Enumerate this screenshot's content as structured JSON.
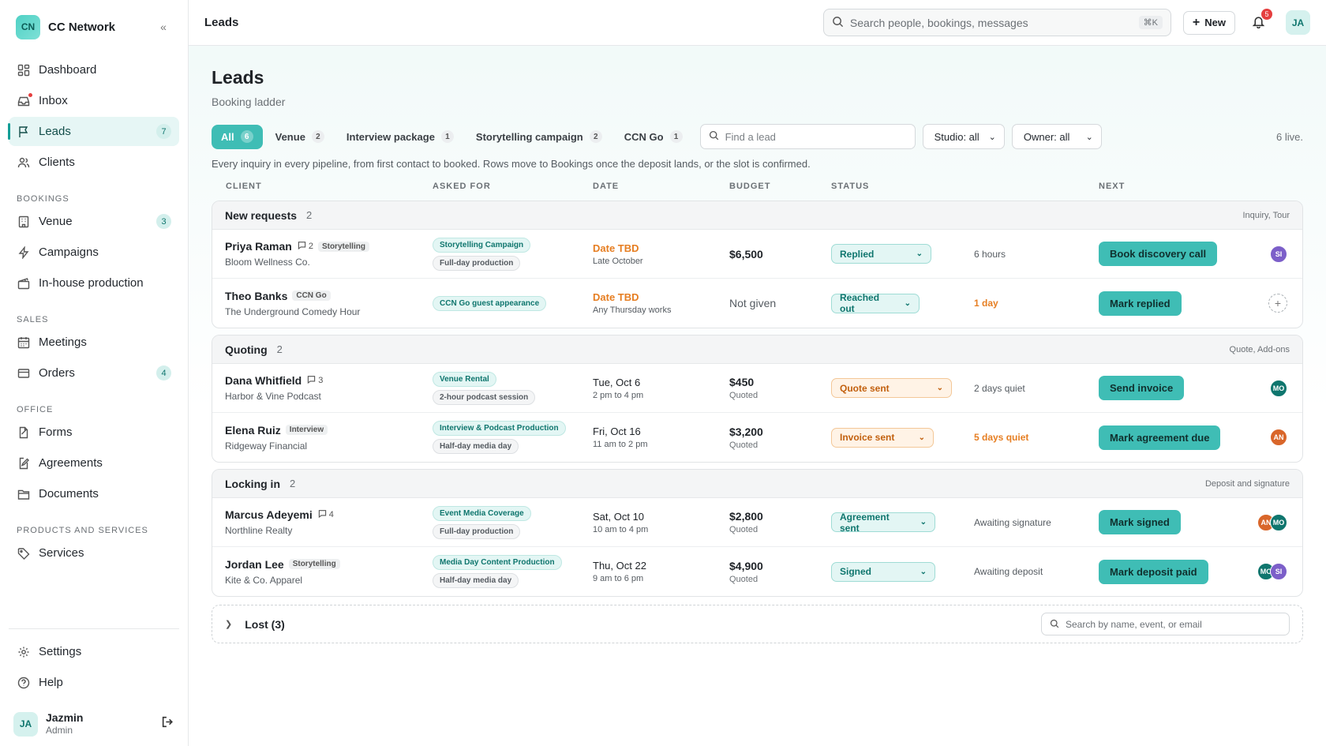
{
  "brand": {
    "initials": "CN",
    "name": "CC Network"
  },
  "sidebar": {
    "main": [
      {
        "label": "Dashboard",
        "icon": "dashboard-icon"
      },
      {
        "label": "Inbox",
        "icon": "inbox-icon"
      },
      {
        "label": "Leads",
        "icon": "flag-icon",
        "count": "7",
        "active": true
      },
      {
        "label": "Clients",
        "icon": "users-icon"
      }
    ],
    "sections": [
      {
        "title": "BOOKINGS",
        "items": [
          {
            "label": "Venue",
            "count": "3"
          },
          {
            "label": "Campaigns"
          },
          {
            "label": "In-house production"
          }
        ]
      },
      {
        "title": "SALES",
        "items": [
          {
            "label": "Meetings"
          },
          {
            "label": "Orders",
            "count": "4"
          }
        ]
      },
      {
        "title": "OFFICE",
        "items": [
          {
            "label": "Forms"
          },
          {
            "label": "Agreements"
          },
          {
            "label": "Documents"
          }
        ]
      },
      {
        "title": "PRODUCTS AND SERVICES",
        "items": [
          {
            "label": "Services"
          }
        ]
      }
    ],
    "footer": [
      {
        "label": "Settings"
      },
      {
        "label": "Help"
      }
    ],
    "user": {
      "initials": "JA",
      "name": "Jazmin",
      "role": "Admin"
    }
  },
  "topbar": {
    "title": "Leads",
    "search_placeholder": "Search people, bookings, messages",
    "shortcut": "⌘K",
    "new_label": "New",
    "notif_count": "5",
    "avatar": "JA"
  },
  "page": {
    "title": "Leads",
    "subtitle": "Booking ladder",
    "live": "6 live.",
    "description": "Every inquiry in every pipeline, from first contact to booked. Rows move to Bookings once the deposit lands, or the slot is confirmed."
  },
  "tabs": [
    {
      "label": "All",
      "count": "6"
    },
    {
      "label": "Venue",
      "count": "2"
    },
    {
      "label": "Interview package",
      "count": "1"
    },
    {
      "label": "Storytelling campaign",
      "count": "2"
    },
    {
      "label": "CCN Go",
      "count": "1"
    }
  ],
  "filters": {
    "find_placeholder": "Find a lead",
    "studio": "Studio: all",
    "owner": "Owner: all"
  },
  "columns": {
    "client": "CLIENT",
    "asked": "ASKED FOR",
    "date": "DATE",
    "budget": "BUDGET",
    "status": "STATUS",
    "next": "NEXT"
  },
  "groups": [
    {
      "name": "New requests",
      "count": "2",
      "hint": "Inquiry, Tour",
      "rows": [
        {
          "name": "Priya Raman",
          "msgs": "2",
          "tag": "Storytelling",
          "company": "Bloom Wellness Co.",
          "chips": [
            "Storytelling Campaign",
            "Full-day production"
          ],
          "date": "Date TBD",
          "date_sub": "Late October",
          "budget": "$6,500",
          "budget_sub": "",
          "status": "Replied",
          "wait": "6 hours",
          "next": "Book discovery call",
          "owners": [
            "SI"
          ]
        },
        {
          "name": "Theo Banks",
          "msgs": "",
          "tag": "CCN Go",
          "company": "The Underground Comedy Hour",
          "chips": [
            "CCN Go guest appearance"
          ],
          "date": "Date TBD",
          "date_sub": "Any Thursday works",
          "budget": "Not given",
          "budget_sub": "",
          "status": "Reached out",
          "wait": "1 day",
          "next": "Mark replied",
          "owners": []
        }
      ]
    },
    {
      "name": "Quoting",
      "count": "2",
      "hint": "Quote, Add-ons",
      "rows": [
        {
          "name": "Dana Whitfield",
          "msgs": "3",
          "tag": "",
          "company": "Harbor & Vine Podcast",
          "chips": [
            "Venue Rental",
            "2-hour podcast session"
          ],
          "date": "Tue, Oct 6",
          "date_sub": "2 pm to 4 pm",
          "budget": "$450",
          "budget_sub": "Quoted",
          "status": "Quote sent",
          "wait": "2 days quiet",
          "next": "Send invoice",
          "owners": [
            "MO"
          ]
        },
        {
          "name": "Elena Ruiz",
          "msgs": "",
          "tag": "Interview",
          "company": "Ridgeway Financial",
          "chips": [
            "Interview & Podcast Production",
            "Half-day media day"
          ],
          "date": "Fri, Oct 16",
          "date_sub": "11 am to 2 pm",
          "budget": "$3,200",
          "budget_sub": "Quoted",
          "status": "Invoice sent",
          "wait": "5 days quiet",
          "next": "Mark agreement due",
          "owners": [
            "AN"
          ]
        }
      ]
    },
    {
      "name": "Locking in",
      "count": "2",
      "hint": "Deposit and signature",
      "rows": [
        {
          "name": "Marcus Adeyemi",
          "msgs": "4",
          "tag": "",
          "company": "Northline Realty",
          "chips": [
            "Event Media Coverage",
            "Full-day production"
          ],
          "date": "Sat, Oct 10",
          "date_sub": "10 am to 4 pm",
          "budget": "$2,800",
          "budget_sub": "Quoted",
          "status": "Agreement sent",
          "wait": "Awaiting signature",
          "next": "Mark signed",
          "owners": [
            "AN",
            "MO"
          ]
        },
        {
          "name": "Jordan Lee",
          "msgs": "",
          "tag": "Storytelling",
          "company": "Kite & Co. Apparel",
          "chips": [
            "Media Day Content Production",
            "Half-day media day"
          ],
          "date": "Thu, Oct 22",
          "date_sub": "9 am to 6 pm",
          "budget": "$4,900",
          "budget_sub": "Quoted",
          "status": "Signed",
          "wait": "Awaiting deposit",
          "next": "Mark deposit paid",
          "owners": [
            "MO",
            "SI"
          ]
        }
      ]
    }
  ],
  "lost": {
    "label": "Lost (3)",
    "search_placeholder": "Search by name, event, or email"
  }
}
